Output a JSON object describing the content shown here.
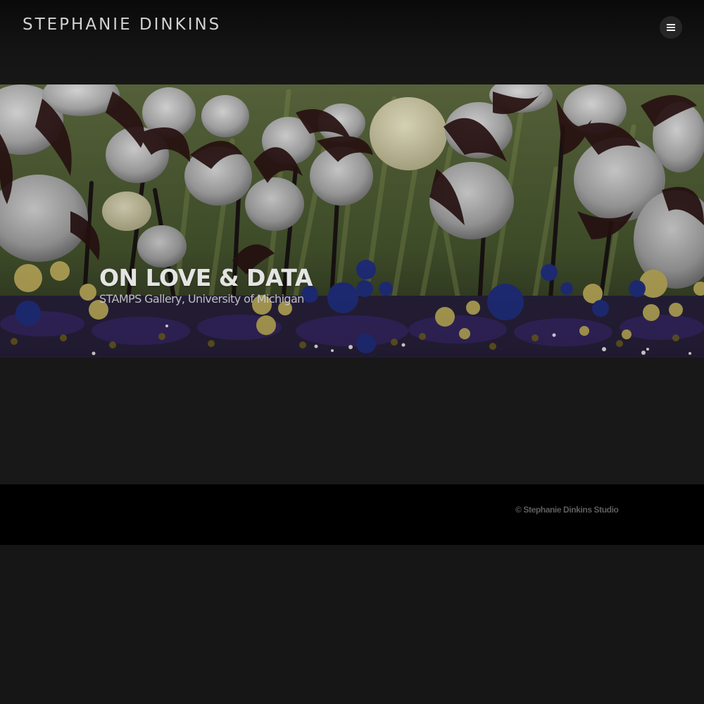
{
  "header": {
    "site_title": "STEPHANIE DINKINS",
    "menu_icon": "hamburger-menu-icon"
  },
  "hero": {
    "title": "ON LOVE & DATA",
    "subtitle": "STAMPS Gallery, University of Michigan"
  },
  "footer": {
    "copyright": "© Stephanie Dinkins Studio"
  },
  "colors": {
    "background": "#161616",
    "header_text": "#d2d2d2",
    "footer_background": "#000000",
    "footer_text": "#5e5e5e"
  }
}
